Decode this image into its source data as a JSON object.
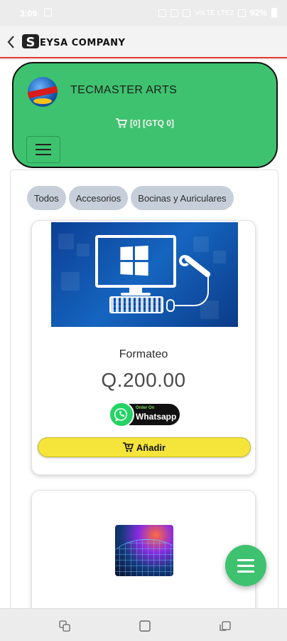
{
  "status_bar": {
    "time": "3:09",
    "battery": "92%",
    "network": "VoLTE LTE2"
  },
  "app_bar": {
    "title": "EYSA COMPANY",
    "logo_letter": "S"
  },
  "store": {
    "name": "TECMASTER ARTS",
    "cart_summary": "[0] [GTQ 0]"
  },
  "categories": [
    {
      "label": "Todos"
    },
    {
      "label": "Accesorios"
    },
    {
      "label": "Bocinas y Auriculares"
    }
  ],
  "products": [
    {
      "title": "Formateo",
      "price": "Q.200.00",
      "whatsapp_small": "Order On",
      "whatsapp_big": "Whatsapp",
      "add_label": "Añadir"
    }
  ],
  "colors": {
    "header_green": "#3ec26f",
    "add_yellow": "#f5e43a",
    "chip_gray": "#c6cfd9",
    "app_bar_red_line": "#e53935",
    "whatsapp_green": "#25d366"
  },
  "icons": {
    "back": "chevron-left-icon",
    "cart": "cart-icon",
    "menu": "hamburger-icon",
    "add_to_cart": "cart-plus-icon",
    "whatsapp": "whatsapp-icon",
    "fab": "hamburger-icon"
  }
}
